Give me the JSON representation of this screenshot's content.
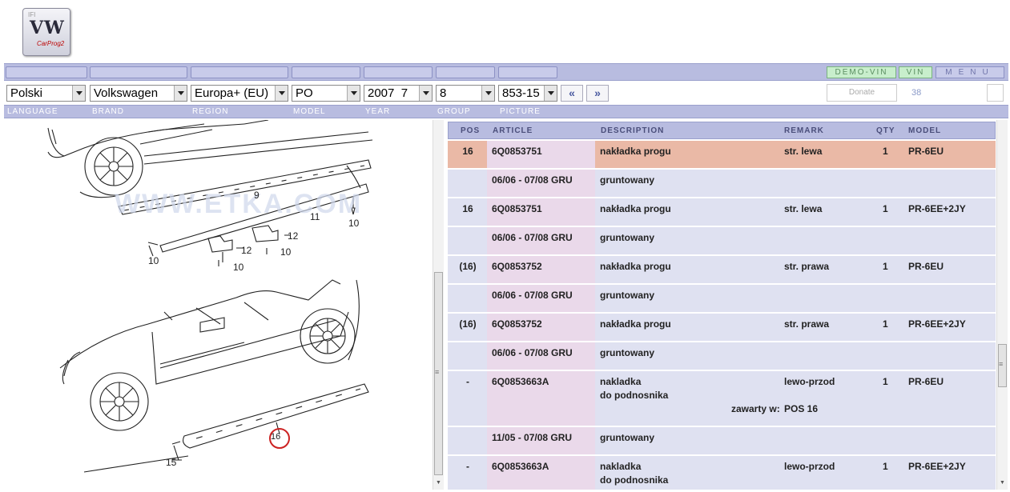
{
  "logo": {
    "small": "IFI",
    "brand": "VW",
    "product": "CarProg2"
  },
  "topbar": {
    "demo_vin": "DEMO-VIN",
    "vin": "VIN",
    "menu": "MENU"
  },
  "selectors": {
    "language": "Polski",
    "brand": "Volkswagen",
    "region": "Europa+ (EU)",
    "model": "PO",
    "year": "2007  7",
    "group": "8",
    "picture": "853-15"
  },
  "nav": {
    "prev": "«",
    "next": "»"
  },
  "donate": "Donate",
  "count": "38",
  "labels": {
    "language": "LANGUAGE",
    "brand": "BRAND",
    "region": "REGION",
    "model": "MODEL",
    "year": "YEAR",
    "group": "GROUP",
    "picture": "PICTURE"
  },
  "illustration": {
    "watermark": "WWW.ETKA.COM",
    "callouts": [
      "9",
      "11",
      "10",
      "12",
      "12",
      "10",
      "10",
      "10",
      "16",
      "15"
    ]
  },
  "table": {
    "headers": {
      "pos": "POS",
      "article": "ARTICLE",
      "description": "DESCRIPTION",
      "remark": "REMARK",
      "qty": "QTY",
      "model": "MODEL"
    },
    "rows": [
      {
        "pos": "16",
        "article": "6Q0853751",
        "desc": "nakładka progu",
        "remark": "str. lewa",
        "qty": "1",
        "model": "PR-6EU"
      },
      {
        "pos": "",
        "article": "06/06 - 07/08  GRU",
        "desc": "gruntowany",
        "remark": "",
        "qty": "",
        "model": ""
      },
      {
        "pos": "16",
        "article": "6Q0853751",
        "desc": "nakładka progu",
        "remark": "str. lewa",
        "qty": "1",
        "model": "PR-6EE+2JY"
      },
      {
        "pos": "",
        "article": "06/06 - 07/08  GRU",
        "desc": "gruntowany",
        "remark": "",
        "qty": "",
        "model": ""
      },
      {
        "pos": "(16)",
        "article": "6Q0853752",
        "desc": "nakładka progu",
        "remark": "str. prawa",
        "qty": "1",
        "model": "PR-6EU"
      },
      {
        "pos": "",
        "article": "06/06 - 07/08  GRU",
        "desc": "gruntowany",
        "remark": "",
        "qty": "",
        "model": ""
      },
      {
        "pos": "(16)",
        "article": "6Q0853752",
        "desc": "nakładka progu",
        "remark": "str. prawa",
        "qty": "1",
        "model": "PR-6EE+2JY"
      },
      {
        "pos": "",
        "article": "06/06 - 07/08  GRU",
        "desc": "gruntowany",
        "remark": "",
        "qty": "",
        "model": ""
      },
      {
        "pos": "-",
        "article": "6Q0853663A",
        "desc": "nakladka",
        "desc2": "do podnosnika",
        "contained_label": "zawarty w:",
        "contained_value": "POS 16",
        "remark": "lewo-przod",
        "qty": "1",
        "model": "PR-6EU"
      },
      {
        "pos": "",
        "article": "11/05 - 07/08  GRU",
        "desc": "gruntowany",
        "remark": "",
        "qty": "",
        "model": ""
      },
      {
        "pos": "-",
        "article": "6Q0853663A",
        "desc": "nakladka",
        "desc2": "do podnosnika",
        "remark": "lewo-przod",
        "qty": "1",
        "model": "PR-6EE+2JY"
      }
    ]
  }
}
